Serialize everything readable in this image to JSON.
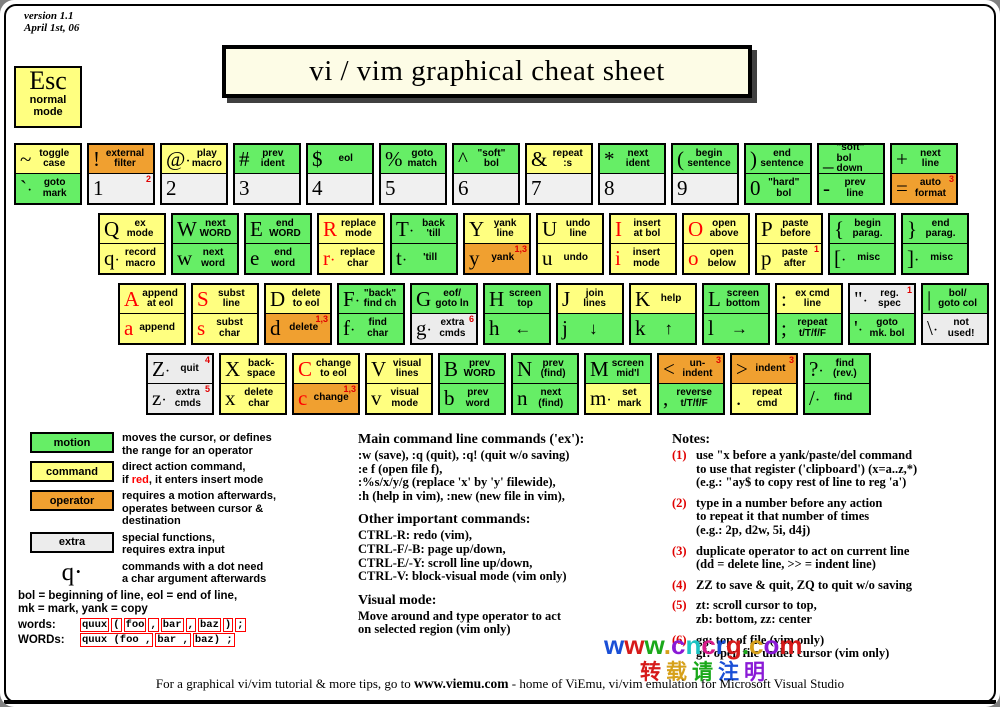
{
  "header": {
    "version_line1": "version 1.1",
    "version_line2": "April 1st, 06",
    "esc_key": "Esc",
    "esc_sub1": "normal",
    "esc_sub2": "mode",
    "title": "vi / vim graphical cheat sheet"
  },
  "colors": {
    "motion": "#66ee66",
    "command": "#ffff80",
    "operator": "#f0a030",
    "extra": "#ececec",
    "red": "#ff0000",
    "title_bg": "#fdfce6",
    "page_bg": "#ffffff"
  },
  "keyboard": {
    "rows": [
      {
        "name": "number-row",
        "offset": 14,
        "keys": [
          {
            "id": "tilde-backtick",
            "top": {
              "glyph": "~",
              "cls": "c-command",
              "desc": "toggle\ncase"
            },
            "bottom": {
              "glyph": "`",
              "dot": true,
              "cls": "c-motion",
              "desc": "goto\nmark"
            }
          },
          {
            "id": "1",
            "top": {
              "glyph": "!",
              "cls": "c-operator",
              "desc": "external\nfilter"
            },
            "bottom": {
              "glyph": "1",
              "cls": "c-white",
              "desc": "",
              "sup": "2"
            }
          },
          {
            "id": "2",
            "top": {
              "glyph": "@",
              "dot": true,
              "cls": "c-command",
              "desc": "play\nmacro"
            },
            "bottom": {
              "glyph": "2",
              "cls": "c-white",
              "desc": ""
            }
          },
          {
            "id": "3",
            "top": {
              "glyph": "#",
              "cls": "c-motion",
              "desc": "prev\nident"
            },
            "bottom": {
              "glyph": "3",
              "cls": "c-white",
              "desc": ""
            }
          },
          {
            "id": "4",
            "top": {
              "glyph": "$",
              "cls": "c-motion",
              "desc": "eol"
            },
            "bottom": {
              "glyph": "4",
              "cls": "c-white",
              "desc": ""
            }
          },
          {
            "id": "5",
            "top": {
              "glyph": "%",
              "cls": "c-motion",
              "desc": "goto\nmatch"
            },
            "bottom": {
              "glyph": "5",
              "cls": "c-white",
              "desc": ""
            }
          },
          {
            "id": "6",
            "top": {
              "glyph": "^",
              "cls": "c-motion",
              "desc": "\"soft\"\nbol"
            },
            "bottom": {
              "glyph": "6",
              "cls": "c-white",
              "desc": ""
            }
          },
          {
            "id": "7",
            "top": {
              "glyph": "&",
              "cls": "c-command",
              "desc": "repeat\n:s"
            },
            "bottom": {
              "glyph": "7",
              "cls": "c-white",
              "desc": ""
            }
          },
          {
            "id": "8",
            "top": {
              "glyph": "*",
              "cls": "c-motion",
              "desc": "next\nident"
            },
            "bottom": {
              "glyph": "8",
              "cls": "c-white",
              "desc": ""
            }
          },
          {
            "id": "9",
            "top": {
              "glyph": "(",
              "cls": "c-motion",
              "desc": "begin\nsentence"
            },
            "bottom": {
              "glyph": "9",
              "cls": "c-white",
              "desc": ""
            }
          },
          {
            "id": "0",
            "top": {
              "glyph": ")",
              "cls": "c-motion",
              "desc": "end\nsentence"
            },
            "bottom": {
              "glyph": "0",
              "cls": "c-motion",
              "desc": "\"hard\"\nbol"
            }
          },
          {
            "id": "minus",
            "top": {
              "glyph": "_",
              "cls": "c-motion",
              "desc": "\"soft\" bol\ndown",
              "descleft": true
            },
            "bottom": {
              "glyph": "-",
              "cls": "c-motion",
              "desc": "prev\nline"
            }
          },
          {
            "id": "equals",
            "top": {
              "glyph": "+",
              "cls": "c-motion",
              "desc": "next\nline"
            },
            "bottom": {
              "glyph": "=",
              "cls": "c-operator",
              "desc": "auto\nformat",
              "sup": "3"
            }
          }
        ]
      },
      {
        "name": "qwerty-row",
        "offset": 98,
        "keys": [
          {
            "id": "q",
            "top": {
              "glyph": "Q",
              "cls": "c-command",
              "desc": "ex\nmode"
            },
            "bottom": {
              "glyph": "q",
              "dot": true,
              "cls": "c-command",
              "desc": "record\nmacro"
            }
          },
          {
            "id": "w",
            "top": {
              "glyph": "W",
              "cls": "c-motion",
              "desc": "next\nWORD"
            },
            "bottom": {
              "glyph": "w",
              "cls": "c-motion",
              "desc": "next\nword"
            }
          },
          {
            "id": "e",
            "top": {
              "glyph": "E",
              "cls": "c-motion",
              "desc": "end\nWORD"
            },
            "bottom": {
              "glyph": "e",
              "cls": "c-motion",
              "desc": "end\nword"
            }
          },
          {
            "id": "r",
            "top": {
              "glyph": "R",
              "red": true,
              "cls": "c-command",
              "desc": "replace\nmode"
            },
            "bottom": {
              "glyph": "r",
              "red": true,
              "dot": true,
              "cls": "c-command",
              "desc": "replace\nchar"
            }
          },
          {
            "id": "t",
            "top": {
              "glyph": "T",
              "dot": true,
              "cls": "c-motion",
              "desc": "back\n'till"
            },
            "bottom": {
              "glyph": "t",
              "dot": true,
              "cls": "c-motion",
              "desc": "'till"
            }
          },
          {
            "id": "y",
            "top": {
              "glyph": "Y",
              "cls": "c-command",
              "desc": "yank\nline"
            },
            "bottom": {
              "glyph": "y",
              "cls": "c-operator",
              "desc": "yank",
              "sup": "1,3"
            }
          },
          {
            "id": "u",
            "top": {
              "glyph": "U",
              "cls": "c-command",
              "desc": "undo\nline"
            },
            "bottom": {
              "glyph": "u",
              "cls": "c-command",
              "desc": "undo"
            }
          },
          {
            "id": "i",
            "top": {
              "glyph": "I",
              "red": true,
              "cls": "c-command",
              "desc": "insert\nat bol"
            },
            "bottom": {
              "glyph": "i",
              "red": true,
              "cls": "c-command",
              "desc": "insert\nmode"
            }
          },
          {
            "id": "o",
            "top": {
              "glyph": "O",
              "red": true,
              "cls": "c-command",
              "desc": "open\nabove"
            },
            "bottom": {
              "glyph": "o",
              "red": true,
              "cls": "c-command",
              "desc": "open\nbelow"
            }
          },
          {
            "id": "p",
            "top": {
              "glyph": "P",
              "cls": "c-command",
              "desc": "paste\nbefore"
            },
            "bottom": {
              "glyph": "p",
              "cls": "c-command",
              "desc": "paste\nafter",
              "sup": "1"
            }
          },
          {
            "id": "lbracket",
            "top": {
              "glyph": "{",
              "cls": "c-motion",
              "desc": "begin\nparag."
            },
            "bottom": {
              "glyph": "[",
              "dot": true,
              "cls": "c-motion",
              "desc": "misc"
            }
          },
          {
            "id": "rbracket",
            "top": {
              "glyph": "}",
              "cls": "c-motion",
              "desc": "end\nparag."
            },
            "bottom": {
              "glyph": "]",
              "dot": true,
              "cls": "c-motion",
              "desc": "misc"
            }
          }
        ]
      },
      {
        "name": "asdf-row",
        "offset": 118,
        "keys": [
          {
            "id": "a",
            "top": {
              "glyph": "A",
              "red": true,
              "cls": "c-command",
              "desc": "append\nat eol"
            },
            "bottom": {
              "glyph": "a",
              "red": true,
              "cls": "c-command",
              "desc": "append"
            }
          },
          {
            "id": "s",
            "top": {
              "glyph": "S",
              "red": true,
              "cls": "c-command",
              "desc": "subst\nline"
            },
            "bottom": {
              "glyph": "s",
              "red": true,
              "cls": "c-command",
              "desc": "subst\nchar"
            }
          },
          {
            "id": "d",
            "top": {
              "glyph": "D",
              "cls": "c-command",
              "desc": "delete\nto eol"
            },
            "bottom": {
              "glyph": "d",
              "cls": "c-operator",
              "desc": "delete",
              "sup": "1,3"
            }
          },
          {
            "id": "f",
            "top": {
              "glyph": "F",
              "dot": true,
              "cls": "c-motion",
              "desc": "\"back\"\nfind ch"
            },
            "bottom": {
              "glyph": "f",
              "dot": true,
              "cls": "c-motion",
              "desc": "find\nchar"
            }
          },
          {
            "id": "g",
            "top": {
              "glyph": "G",
              "cls": "c-motion",
              "desc": "eof/\ngoto ln"
            },
            "bottom": {
              "glyph": "g",
              "dot": true,
              "cls": "c-extra",
              "desc": "extra\ncmds",
              "sup": "6"
            }
          },
          {
            "id": "h",
            "top": {
              "glyph": "H",
              "cls": "c-motion",
              "desc": "screen\ntop"
            },
            "bottom": {
              "glyph": "h",
              "cls": "c-motion",
              "desc": "←",
              "arrow": true
            }
          },
          {
            "id": "j",
            "top": {
              "glyph": "J",
              "cls": "c-command",
              "desc": "join\nlines"
            },
            "bottom": {
              "glyph": "j",
              "cls": "c-motion",
              "desc": "↓",
              "arrow": true
            }
          },
          {
            "id": "k",
            "top": {
              "glyph": "K",
              "cls": "c-command",
              "desc": "help"
            },
            "bottom": {
              "glyph": "k",
              "cls": "c-motion",
              "desc": "↑",
              "arrow": true
            }
          },
          {
            "id": "l",
            "top": {
              "glyph": "L",
              "cls": "c-motion",
              "desc": "screen\nbottom"
            },
            "bottom": {
              "glyph": "l",
              "cls": "c-motion",
              "desc": "→",
              "arrow": true
            }
          },
          {
            "id": "semicolon",
            "top": {
              "glyph": ":",
              "cls": "c-command",
              "desc": "ex cmd\nline"
            },
            "bottom": {
              "glyph": ";",
              "cls": "c-motion",
              "desc": "repeat\nt/T/f/F"
            }
          },
          {
            "id": "quote",
            "top": {
              "glyph": "\"",
              "dot": true,
              "cls": "c-extra",
              "desc": "reg.\nspec",
              "sup": "1"
            },
            "bottom": {
              "glyph": "'",
              "dot": true,
              "cls": "c-motion",
              "desc": "goto\nmk. bol"
            }
          },
          {
            "id": "backslash",
            "top": {
              "glyph": "|",
              "cls": "c-motion",
              "desc": "bol/\ngoto col"
            },
            "bottom": {
              "glyph": "\\",
              "dot": true,
              "cls": "c-extra",
              "desc": "not\nused!"
            }
          }
        ]
      },
      {
        "name": "zxcv-row",
        "offset": 146,
        "keys": [
          {
            "id": "z",
            "top": {
              "glyph": "Z",
              "dot": true,
              "cls": "c-extra",
              "desc": "quit",
              "sup": "4"
            },
            "bottom": {
              "glyph": "z",
              "dot": true,
              "cls": "c-extra",
              "desc": "extra\ncmds",
              "sup": "5"
            }
          },
          {
            "id": "x",
            "top": {
              "glyph": "X",
              "cls": "c-command",
              "desc": "back-\nspace"
            },
            "bottom": {
              "glyph": "x",
              "cls": "c-command",
              "desc": "delete\nchar"
            }
          },
          {
            "id": "c",
            "top": {
              "glyph": "C",
              "red": true,
              "cls": "c-command",
              "desc": "change\nto eol"
            },
            "bottom": {
              "glyph": "c",
              "red": true,
              "cls": "c-operator",
              "desc": "change",
              "sup": "1,3"
            }
          },
          {
            "id": "v",
            "top": {
              "glyph": "V",
              "cls": "c-command",
              "desc": "visual\nlines"
            },
            "bottom": {
              "glyph": "v",
              "cls": "c-command",
              "desc": "visual\nmode"
            }
          },
          {
            "id": "b",
            "top": {
              "glyph": "B",
              "cls": "c-motion",
              "desc": "prev\nWORD"
            },
            "bottom": {
              "glyph": "b",
              "cls": "c-motion",
              "desc": "prev\nword"
            }
          },
          {
            "id": "n",
            "top": {
              "glyph": "N",
              "cls": "c-motion",
              "desc": "prev\n(find)"
            },
            "bottom": {
              "glyph": "n",
              "cls": "c-motion",
              "desc": "next\n(find)"
            }
          },
          {
            "id": "m",
            "top": {
              "glyph": "M",
              "cls": "c-motion",
              "desc": "screen\nmid'l"
            },
            "bottom": {
              "glyph": "m",
              "dot": true,
              "cls": "c-command",
              "desc": "set\nmark"
            }
          },
          {
            "id": "comma",
            "top": {
              "glyph": "<",
              "cls": "c-operator",
              "desc": "un-\nindent",
              "sup": "3"
            },
            "bottom": {
              "glyph": ",",
              "cls": "c-motion",
              "desc": "reverse\nt/T/f/F"
            }
          },
          {
            "id": "period",
            "top": {
              "glyph": ">",
              "cls": "c-operator",
              "desc": "indent",
              "sup": "3"
            },
            "bottom": {
              "glyph": ".",
              "cls": "c-command",
              "desc": "repeat\ncmd"
            }
          },
          {
            "id": "slash",
            "top": {
              "glyph": "?",
              "dot": true,
              "cls": "c-motion",
              "desc": "find\n(rev.)"
            },
            "bottom": {
              "glyph": "/",
              "dot": true,
              "cls": "c-motion",
              "desc": "find"
            }
          }
        ]
      }
    ]
  },
  "legend": {
    "items": [
      {
        "label": "motion",
        "cls": "c-motion",
        "text": "moves the cursor, or defines\nthe range for an operator"
      },
      {
        "label": "command",
        "cls": "c-command",
        "text": "direct action command,\nif red, it enters insert mode",
        "red_word": "red"
      },
      {
        "label": "operator",
        "cls": "c-operator",
        "text": "requires a motion afterwards,\noperates between cursor  &\ndestination"
      },
      {
        "label": "extra",
        "cls": "c-extra",
        "text": "special functions,\nrequires extra input"
      }
    ],
    "dot_glyph": "q·",
    "dot_text": "commands with a dot need\na char argument afterwards",
    "abbrev": "bol = beginning of line, eol = end of line,\nmk = mark, yank = copy",
    "words_label": "words:",
    "words_tokens": [
      "quux",
      "(",
      "foo",
      ",",
      "bar",
      ",",
      "baz",
      ")",
      ";"
    ],
    "wordsbig_label": "WORDs:",
    "wordsbig_tokens": [
      "quux (foo ,",
      "bar ,",
      "baz) ;"
    ]
  },
  "middle": {
    "h1": "Main command line commands ('ex'):",
    "p1": ":w (save), :q (quit), :q! (quit w/o saving)\n:e f (open file f),\n:%s/x/y/g (replace 'x' by 'y' filewide),\n:h (help in vim), :new (new file in vim),",
    "h2": "Other important commands:",
    "p2": "CTRL-R: redo (vim),\nCTRL-F/-B: page up/down,\nCTRL-E/-Y: scroll line up/down,\nCTRL-V: block-visual mode (vim only)",
    "h3": "Visual mode:",
    "p3": "Move around and type operator to act\non selected region (vim only)"
  },
  "notes": {
    "title": "Notes:",
    "items": [
      {
        "num": "(1)",
        "text": "use \"x before a yank/paste/del command\nto use that register ('clipboard') (x=a..z,*)\n(e.g.: \"ay$ to copy rest of line to reg 'a')"
      },
      {
        "num": "(2)",
        "text": "type in a number before any action\nto repeat it that number of times\n(e.g.: 2p, d2w, 5i, d4j)"
      },
      {
        "num": "(3)",
        "text": "duplicate operator to act on current line\n(dd = delete line, >> = indent line)"
      },
      {
        "num": "(4)",
        "text": "ZZ to save & quit, ZQ to quit w/o saving"
      },
      {
        "num": "(5)",
        "text": "zt: scroll cursor to top,\nzb: bottom, zz: center"
      },
      {
        "num": "(6)",
        "text": "gg: top of file (vim only)\ngf: open file under cursor (vim only)"
      }
    ]
  },
  "watermark": {
    "url": "www.cncrg.com",
    "sub": "转载请注明"
  },
  "footer": {
    "pre": "For a graphical vi/vim tutorial & more tips, go to  ",
    "site": "www.viemu.com",
    "post": "  - home of ViEmu, vi/vim emulation for Microsoft Visual Studio"
  }
}
